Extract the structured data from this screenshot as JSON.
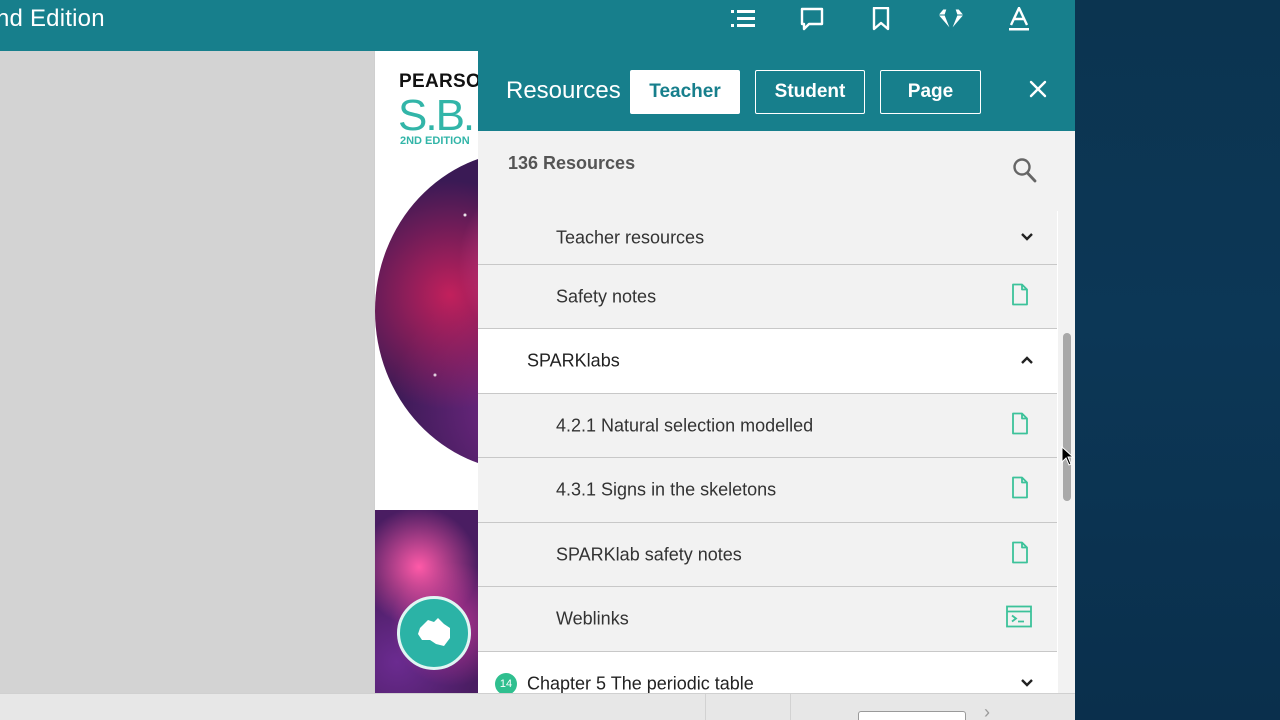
{
  "app": {
    "title_fragment": "nd Edition",
    "toolbar_icons": [
      "table-of-contents-icon",
      "comment-icon",
      "bookmark-icon",
      "diamond-icon",
      "text-style-icon"
    ]
  },
  "cover": {
    "publisher": "PEARSO",
    "series": "S.B.",
    "edition": "2ND EDITION",
    "badge": "AUSTRALIAN CURRICULUM"
  },
  "panel": {
    "title": "Resources",
    "tabs": [
      {
        "label": "Teacher",
        "active": true
      },
      {
        "label": "Student",
        "active": false
      },
      {
        "label": "Page",
        "active": false
      }
    ],
    "close_icon": "close-icon",
    "count_label": "136 Resources",
    "search_icon": "search-icon",
    "items": [
      {
        "label": "Teacher resources",
        "level": "sub",
        "icon": "chevron-down-icon"
      },
      {
        "label": "Safety notes",
        "level": "sub",
        "icon": "document-icon"
      },
      {
        "label": "SPARKlabs",
        "level": "group",
        "icon": "chevron-up-icon"
      },
      {
        "label": "4.2.1 Natural selection modelled",
        "level": "sub",
        "icon": "document-icon"
      },
      {
        "label": "4.3.1 Signs in the skeletons",
        "level": "sub",
        "icon": "document-icon"
      },
      {
        "label": "SPARKlab safety notes",
        "level": "sub",
        "icon": "document-icon"
      },
      {
        "label": "Weblinks",
        "level": "sub",
        "icon": "weblink-icon"
      },
      {
        "label": "Chapter 5 The periodic table",
        "level": "group",
        "icon": "chevron-down-icon",
        "number": "14"
      }
    ]
  },
  "colors": {
    "teal": "#177f8c",
    "icon_green": "#3cc29a",
    "desktop": "#0b3350"
  }
}
